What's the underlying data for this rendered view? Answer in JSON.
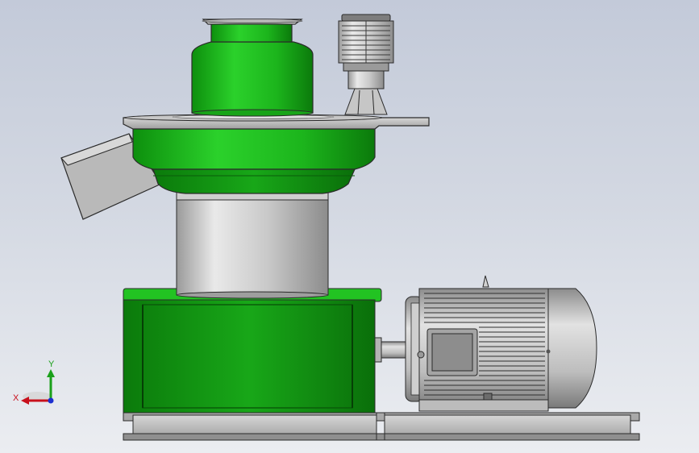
{
  "view": {
    "background_top": "#c3cad9",
    "background_bottom": "#ebedf1"
  },
  "colors": {
    "body_green": "#1db01d",
    "body_green_dark": "#0f7d0f",
    "steel": "#b8b8b8",
    "steel_dark": "#6e6e6e",
    "outline": "#2b2b2b"
  },
  "triad": {
    "x_label": "X",
    "y_label": "Y",
    "x_color": "#c8101c",
    "y_color": "#1aa01a",
    "z_color": "#1c2fd0"
  },
  "parts": [
    "feed-inlet-hopper-ring",
    "upper-green-cylinder",
    "gear-reducer-motor",
    "flange-plate",
    "green-pressing-chamber",
    "discharge-chute",
    "grey-column",
    "green-gearbox-base",
    "shaft-coupling",
    "main-electric-motor",
    "skid-frame"
  ]
}
